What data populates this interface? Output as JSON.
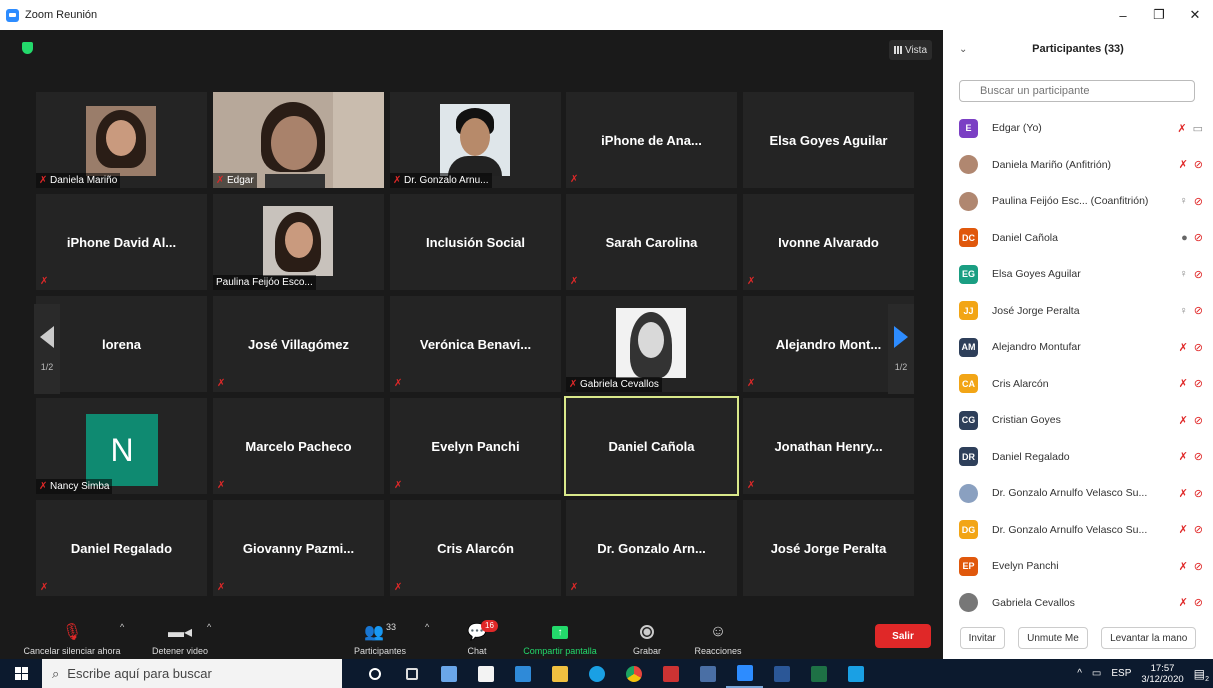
{
  "window": {
    "title": "Zoom Reunión",
    "minimize": "–",
    "restore": "❐",
    "close": "✕"
  },
  "vista_label": "Vista",
  "tiles": [
    {
      "name": "Daniela Mariño",
      "type": "photo-label"
    },
    {
      "name": "Edgar",
      "type": "photo-label"
    },
    {
      "name": "Dr. Gonzalo Arnu...",
      "type": "photo-label"
    },
    {
      "name": "iPhone de Ana...",
      "type": "name"
    },
    {
      "name": "Elsa Goyes Aguilar",
      "type": "name"
    },
    {
      "name": "iPhone David Al...",
      "type": "name"
    },
    {
      "name": "Paulina Feijóo Esco...",
      "type": "photo-label"
    },
    {
      "name": "Inclusión Social",
      "type": "name"
    },
    {
      "name": "Sarah Carolina",
      "type": "name"
    },
    {
      "name": "Ivonne Alvarado",
      "type": "name"
    },
    {
      "name": "lorena",
      "type": "name"
    },
    {
      "name": "José Villagómez",
      "type": "name"
    },
    {
      "name": "Verónica Benavi...",
      "type": "name"
    },
    {
      "name": "Gabriela Cevallos",
      "type": "photo-label"
    },
    {
      "name": "Alejandro Mont...",
      "type": "name"
    },
    {
      "name": "Nancy Simba",
      "type": "avatar-label",
      "initial": "N"
    },
    {
      "name": "Marcelo Pacheco",
      "type": "name"
    },
    {
      "name": "Evelyn Panchi",
      "type": "name"
    },
    {
      "name": "Daniel Cañola",
      "type": "name"
    },
    {
      "name": "Jonathan Henry...",
      "type": "name"
    },
    {
      "name": "Daniel Regalado",
      "type": "name"
    },
    {
      "name": "Giovanny Pazmi...",
      "type": "name"
    },
    {
      "name": "Cris Alarcón",
      "type": "name"
    },
    {
      "name": "Dr. Gonzalo Arn...",
      "type": "name"
    },
    {
      "name": "José Jorge Peralta",
      "type": "name"
    }
  ],
  "pager": {
    "left": "1/2",
    "right": "1/2"
  },
  "toolbar": {
    "mute_label": "Cancelar silenciar ahora",
    "video_label": "Detener video",
    "participants_label": "Participantes",
    "participants_count": "33",
    "chat_label": "Chat",
    "chat_badge": "16",
    "share_label": "Compartir pantalla",
    "record_label": "Grabar",
    "reactions_label": "Reacciones",
    "leave_label": "Salir"
  },
  "panel": {
    "title": "Participantes (33)",
    "search_placeholder": "Buscar un participante",
    "participants": [
      {
        "initials": "E",
        "color": "#7b3fc4",
        "name": "Edgar (Yo)",
        "mic": "off",
        "cam": "on"
      },
      {
        "initials": "",
        "color": "#b08770",
        "name": "Daniela Mariño (Anfitrión)",
        "mic": "off",
        "cam": "off",
        "photo": true
      },
      {
        "initials": "",
        "color": "#b08770",
        "name": "Paulina Feijóo Esc...  (Coanfitrión)",
        "mic": "on",
        "cam": "off",
        "photo": true
      },
      {
        "initials": "DC",
        "color": "#e0580c",
        "name": "Daniel Cañola",
        "mic": "active",
        "cam": "off"
      },
      {
        "initials": "EG",
        "color": "#1a9e82",
        "name": "Elsa Goyes Aguilar",
        "mic": "on",
        "cam": "off"
      },
      {
        "initials": "JJ",
        "color": "#f2a516",
        "name": "José Jorge Peralta",
        "mic": "on",
        "cam": "off"
      },
      {
        "initials": "AM",
        "color": "#2e3f5a",
        "name": "Alejandro Montufar",
        "mic": "off",
        "cam": "off"
      },
      {
        "initials": "CA",
        "color": "#f2a516",
        "name": "Cris Alarcón",
        "mic": "off",
        "cam": "off"
      },
      {
        "initials": "CG",
        "color": "#2e3f5a",
        "name": "Cristian Goyes",
        "mic": "off",
        "cam": "off"
      },
      {
        "initials": "DR",
        "color": "#2e3f5a",
        "name": "Daniel Regalado",
        "mic": "off",
        "cam": "off"
      },
      {
        "initials": "",
        "color": "#8aa0c0",
        "name": "Dr. Gonzalo Arnulfo Velasco Su...",
        "mic": "off",
        "cam": "off",
        "photo": true
      },
      {
        "initials": "DG",
        "color": "#f2a516",
        "name": "Dr. Gonzalo Arnulfo Velasco Su...",
        "mic": "off",
        "cam": "off"
      },
      {
        "initials": "EP",
        "color": "#e0580c",
        "name": "Evelyn Panchi",
        "mic": "off",
        "cam": "off"
      },
      {
        "initials": "",
        "color": "#777",
        "name": "Gabriela Cevallos",
        "mic": "off",
        "cam": "off",
        "photo": true
      }
    ],
    "invite": "Invitar",
    "unmute_me": "Unmute Me",
    "raise_hand": "Levantar la mano"
  },
  "taskbar": {
    "search_text": "Escribe aquí para buscar",
    "lang": "ESP",
    "time": "17:57",
    "date": "3/12/2020",
    "notif_count": "2"
  }
}
